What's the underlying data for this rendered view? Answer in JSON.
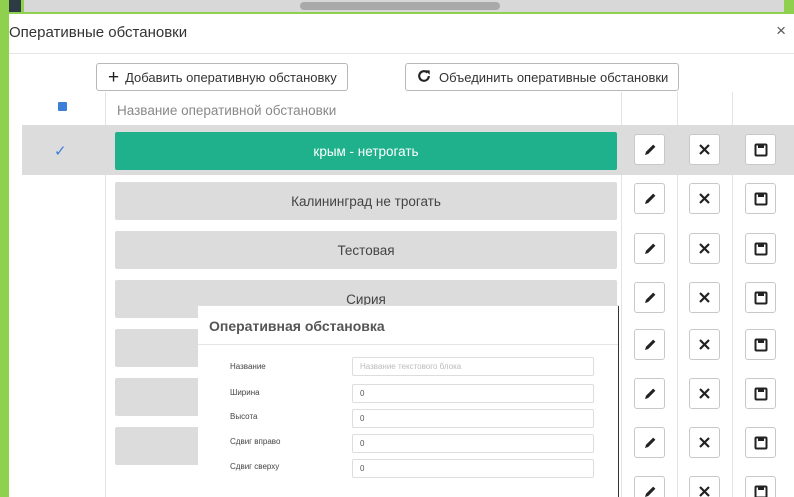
{
  "modal": {
    "title": "Оперативные обстановки",
    "close_glyph": "×"
  },
  "toolbar": {
    "add_label": "Добавить оперативную обстановку",
    "add_icon": "plus-icon",
    "merge_label": "Объединить оперативные обстановки",
    "merge_icon": "refresh-icon"
  },
  "table": {
    "column_header": "Название оперативной обстановки",
    "rows": [
      {
        "name": "крым - нетрогать",
        "selected": true
      },
      {
        "name": "Калининград не трогать",
        "selected": false
      },
      {
        "name": "Тестовая",
        "selected": false
      },
      {
        "name": "Сирия",
        "selected": false
      },
      {
        "name": "",
        "selected": false
      },
      {
        "name": "",
        "selected": false
      },
      {
        "name": "",
        "selected": false
      }
    ],
    "row_actions": [
      "edit-icon",
      "delete-icon",
      "save-icon"
    ]
  },
  "panel": {
    "title": "Оперативная обстановка",
    "fields": [
      {
        "label": "Название",
        "value": "",
        "placeholder": "Название текстового блока"
      },
      {
        "label": "Ширина",
        "value": "0",
        "placeholder": ""
      },
      {
        "label": "Высота",
        "value": "0",
        "placeholder": ""
      },
      {
        "label": "Сдвиг вправо",
        "value": "0",
        "placeholder": ""
      },
      {
        "label": "Сдвиг сверху",
        "value": "0",
        "placeholder": ""
      }
    ]
  },
  "colors": {
    "background_green": "#8fd14f",
    "selected_row_teal": "#1fb18c",
    "checkbox_blue": "#3b7fd9",
    "row_grey": "#dcdcdc"
  }
}
